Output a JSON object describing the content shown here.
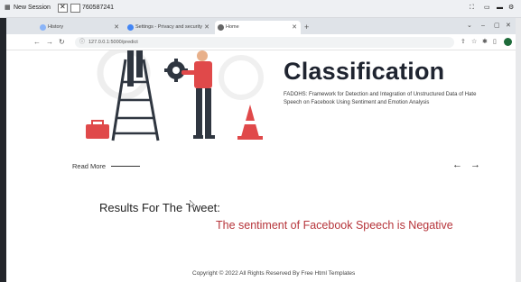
{
  "session": {
    "label": "New Session",
    "id_text": "760587241"
  },
  "browser": {
    "tabs": [
      {
        "title": "History",
        "active": false
      },
      {
        "title": "Settings - Privacy and security",
        "active": false
      },
      {
        "title": "Home",
        "active": true
      }
    ],
    "new_tab_icon": "+",
    "url": "127.0.0.1:5000/predict",
    "window_controls": [
      "⌄",
      "–",
      "▢",
      "✕"
    ]
  },
  "hero": {
    "title": "Classification",
    "description": "FADOHS: Framework for Detection and Integration of Unstructured Data of Hate Speech on Facebook Using Sentiment and Emotion Analysis"
  },
  "slider": {
    "read_more": "Read More",
    "prev_icon": "←",
    "next_icon": "→"
  },
  "results": {
    "heading": "Results For The Tweet:",
    "sentiment_text": "The sentiment of Facebook Speech is Negative"
  },
  "footer": {
    "copyright": "Copyright © 2022 All Rights Reserved By Free Html Templates"
  },
  "colors": {
    "sentiment_red": "#b6343a",
    "title_dark": "#1f2430",
    "illustration_red": "#e0494a"
  }
}
